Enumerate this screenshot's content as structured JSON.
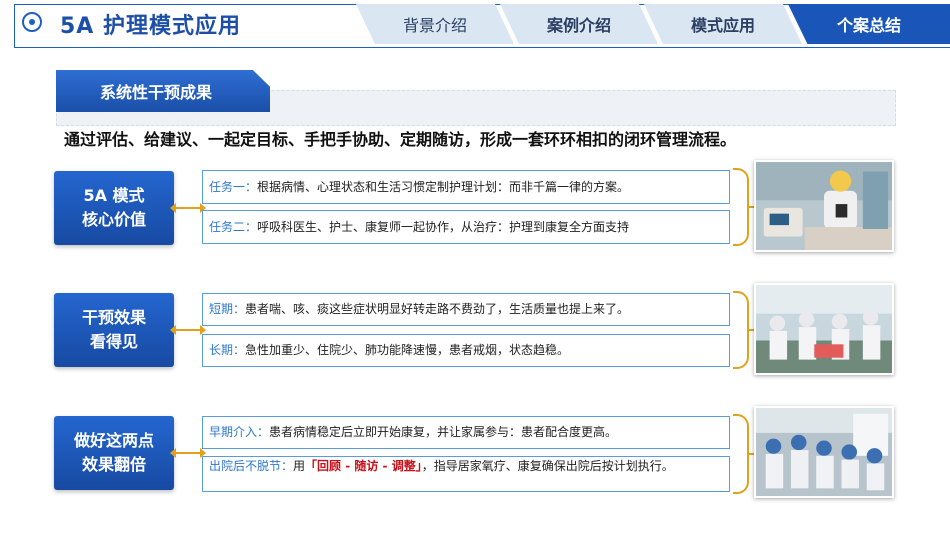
{
  "header": {
    "title": "5A 护理模式应用",
    "tabs": [
      {
        "label": "背景介绍",
        "active": false
      },
      {
        "label": "案例介绍",
        "active": false
      },
      {
        "label": "模式应用",
        "active": false
      },
      {
        "label": "个案总结",
        "active": true
      }
    ]
  },
  "section": {
    "title": "系统性干预成果",
    "intro": "通过评估、给建议、一起定目标、手把手协助、定期随访，形成一套环环相扣的闭环管理流程。"
  },
  "rows": [
    {
      "label_lines": [
        "5A  模式",
        "核心价值"
      ],
      "items": [
        {
          "key": "任务一：",
          "text": "根据病情、心理状态和生活习惯定制护理计划：而非千篇一律的方案。"
        },
        {
          "key": "任务二：",
          "text": "呼吸科医生、护士、康复师一起协作，从治疗：护理到康复全方面支持"
        }
      ]
    },
    {
      "label_lines": [
        "干预效果",
        "看得见"
      ],
      "items": [
        {
          "key": "短期：",
          "text": "患者喘、咳、痰这些症状明显好转走路不费劲了，生活质量也提上来了。"
        },
        {
          "key": "长期：",
          "text": "急性加重少、住院少、肺功能降速慢，患者戒烟，状态趋稳。"
        }
      ]
    },
    {
      "label_lines": [
        "做好这两点",
        "效果翻倍"
      ],
      "items": [
        {
          "key": "早期介入：",
          "text": "患者病情稳定后立即开始康复，并让家属参与：患者配合度更高。"
        },
        {
          "key": "出院后不脱节：",
          "text_pre": "用",
          "highlight": "「回顾 - 随访 - 调整」",
          "text_post": "，指导居家氧疗、康复确保出院后按计划执行。"
        }
      ]
    }
  ],
  "colors": {
    "primary": "#1a56b8",
    "accent": "#e0a21c",
    "highlight": "#c8101a",
    "key_text": "#2f77cf"
  }
}
